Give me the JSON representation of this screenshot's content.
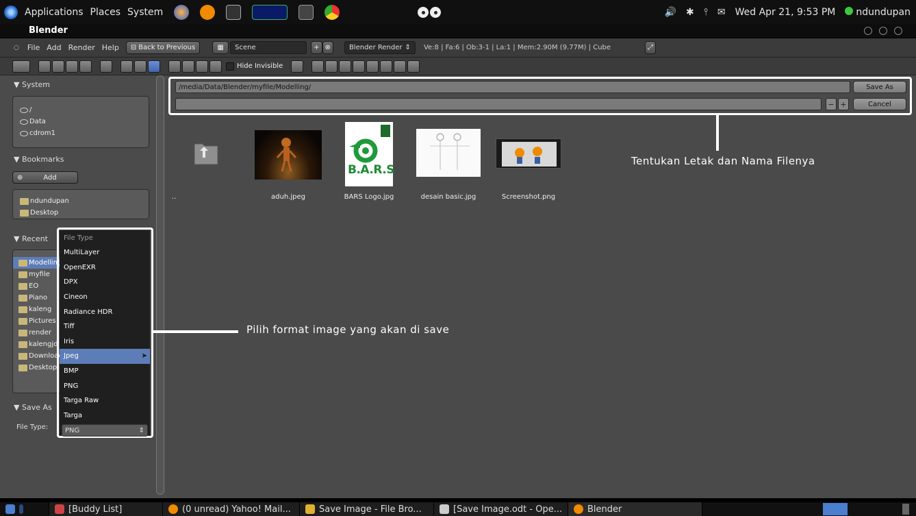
{
  "top_panel": {
    "menus": [
      "Applications",
      "Places",
      "System"
    ],
    "clock": "Wed Apr 21,  9:53 PM",
    "user": "ndundupan"
  },
  "window": {
    "title": "Blender"
  },
  "header": {
    "menus": [
      "File",
      "Add",
      "Render",
      "Help"
    ],
    "back_button": "Back to Previous",
    "scene": "Scene",
    "render_engine": "Blender Render",
    "stats": "Ve:8 | Fa:6 | Ob:3-1 | La:1 | Mem:2.90M (9.77M) | Cube"
  },
  "toolbar": {
    "hide_invisible": "Hide Invisible"
  },
  "sidebar": {
    "system_title": "System",
    "system_items": [
      "/",
      "Data",
      "cdrom1"
    ],
    "bookmarks_title": "Bookmarks",
    "add_label": "Add",
    "bookmark_items": [
      "ndundupan",
      "Desktop"
    ],
    "recent_title": "Recent",
    "recent_items": [
      "Modelling",
      "myfile",
      "EO",
      "Piano",
      "kaleng",
      "Pictures",
      "render",
      "kalengjd",
      "Downloads",
      "Desktop"
    ],
    "save_as_title": "Save As",
    "file_type_label": "File Type:"
  },
  "file_browser": {
    "path": "/media/Data/Blender/myfile/Modelling/",
    "filename": "",
    "save_label": "Save As",
    "cancel_label": "Cancel",
    "parent_label": "..",
    "files": [
      "aduh.jpeg",
      "BARS Logo.jpg",
      "desain basic.jpg",
      "Screenshot.png"
    ],
    "bars_logo_text": "B.A.R.S"
  },
  "dropdown": {
    "heading": "File Type",
    "items": [
      "MultiLayer",
      "OpenEXR",
      "DPX",
      "Cineon",
      "Radiance HDR",
      "Tiff",
      "Iris",
      "Jpeg",
      "BMP",
      "PNG",
      "Targa Raw",
      "Targa"
    ],
    "active": "Jpeg",
    "current": "PNG"
  },
  "annotations": {
    "top": "Tentukan Letak dan Nama Filenya",
    "left": "Pilih format image yang akan di save"
  },
  "taskbar": {
    "items": [
      "[Buddy List]",
      "(0 unread) Yahoo! Mail...",
      "Save Image - File Bro...",
      "[Save Image.odt - Ope...",
      "Blender"
    ]
  },
  "colors": {
    "selection": "#5d7db8",
    "panel": "#4b4b4b",
    "annotation": "#ffffff"
  }
}
